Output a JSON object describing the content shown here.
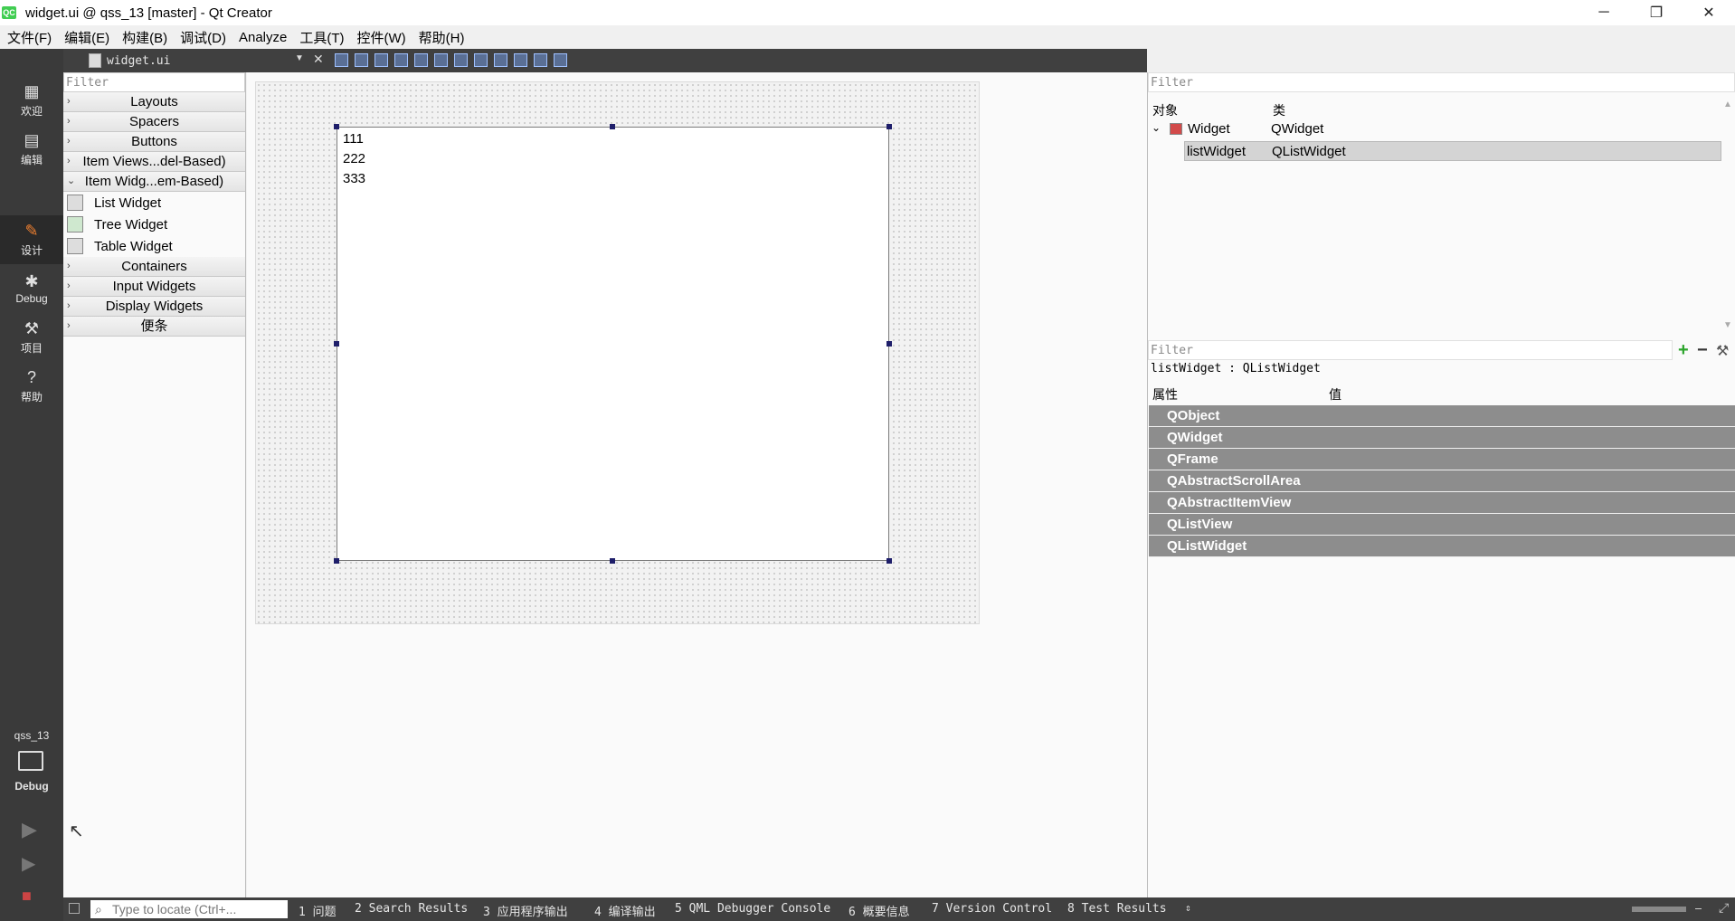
{
  "window": {
    "title": "widget.ui @ qss_13 [master] - Qt Creator",
    "app_icon": "QC",
    "minimize_glyph": "─",
    "restore_glyph": "❐",
    "close_glyph": "✕"
  },
  "menubar": {
    "items": [
      "文件(F)",
      "编辑(E)",
      "构建(B)",
      "调试(D)",
      "Analyze",
      "工具(T)",
      "控件(W)",
      "帮助(H)"
    ]
  },
  "modebar": {
    "modes": [
      {
        "label": "欢迎",
        "icon": "grid-icon",
        "active": false
      },
      {
        "label": "编辑",
        "icon": "document-icon",
        "active": false
      },
      {
        "label": "设计",
        "icon": "pencil-icon",
        "active": true
      },
      {
        "label": "Debug",
        "icon": "bug-icon",
        "active": false
      },
      {
        "label": "项目",
        "icon": "wrench-icon",
        "active": false
      },
      {
        "label": "帮助",
        "icon": "help-icon",
        "active": false
      }
    ],
    "project_name": "qss_13",
    "build_config": "Debug"
  },
  "editor_toolbar": {
    "file_name": "widget.ui"
  },
  "widget_box": {
    "filter_placeholder": "Filter",
    "categories": [
      {
        "label": "Layouts",
        "expanded": false
      },
      {
        "label": "Spacers",
        "expanded": false
      },
      {
        "label": "Buttons",
        "expanded": false
      },
      {
        "label": "Item Views...del-Based)",
        "expanded": false
      },
      {
        "label": "Item Widg...em-Based)",
        "expanded": true
      }
    ],
    "expanded_items": [
      "List Widget",
      "Tree Widget",
      "Table Widget"
    ],
    "more_categories": [
      {
        "label": "Containers"
      },
      {
        "label": "Input Widgets"
      },
      {
        "label": "Display Widgets"
      },
      {
        "label": "便条"
      }
    ]
  },
  "form": {
    "list_items": [
      "111",
      "222",
      "333"
    ]
  },
  "object_inspector": {
    "filter_placeholder": "Filter",
    "col_object": "对象",
    "col_class": "类",
    "rows": [
      {
        "object": "Widget",
        "class": "QWidget"
      },
      {
        "object": "listWidget",
        "class": "QListWidget"
      }
    ]
  },
  "property_editor": {
    "filter_placeholder": "Filter",
    "current": "listWidget : QListWidget",
    "col_property": "属性",
    "col_value": "值",
    "groups": [
      "QObject",
      "QWidget",
      "QFrame",
      "QAbstractScrollArea",
      "QAbstractItemView",
      "QListView",
      "QListWidget"
    ]
  },
  "statusbar": {
    "locator_placeholder": "Type to locate (Ctrl+...",
    "tabs": [
      "1 问题",
      "2 Search Results",
      "3 应用程序输出",
      "4 编译输出",
      "5 QML Debugger Console",
      "6 概要信息",
      "7 Version Control",
      "8 Test Results"
    ]
  },
  "colors": {
    "modebar_bg": "#3a3a3a",
    "selection": "#d4d4d4",
    "propgroup_bg": "#8d8d8d",
    "handle": "#1e1e6a"
  }
}
